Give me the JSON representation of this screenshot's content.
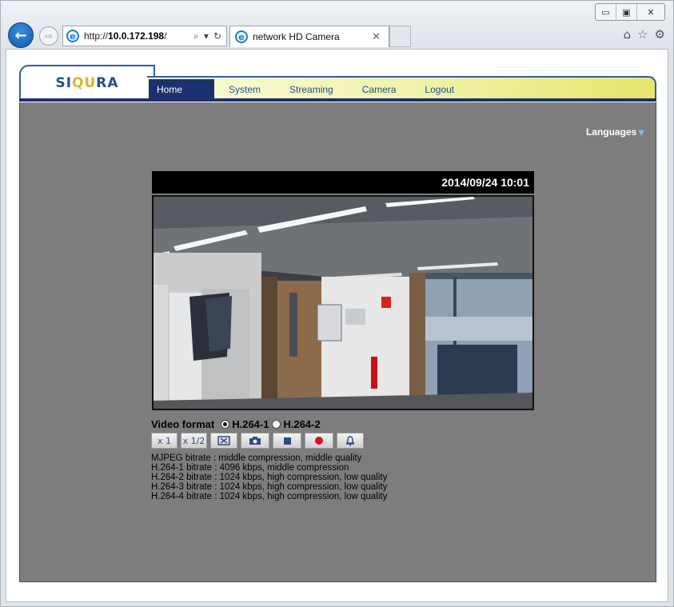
{
  "browser": {
    "url_prefix": "http://",
    "url_host": "10.0.172.198",
    "url_suffix": "/",
    "tab_title": "network HD Camera",
    "window_buttons": [
      "▭",
      "▣",
      "✕"
    ],
    "nav_icons": [
      "home-icon",
      "star-icon",
      "gear-icon"
    ]
  },
  "brand": {
    "logo_main": "SIQURA",
    "logo_accent_color": "#e4b02d",
    "primary_color": "#1f4f93"
  },
  "nav": {
    "items": [
      {
        "label": "Home",
        "active": true
      },
      {
        "label": "System",
        "active": false
      },
      {
        "label": "Streaming",
        "active": false
      },
      {
        "label": "Camera",
        "active": false
      },
      {
        "label": "Logout",
        "active": false
      }
    ]
  },
  "page": {
    "languages_label": "Languages",
    "timestamp": "2014/09/24 10:01",
    "video_format_label": "Video format",
    "video_format_options": [
      {
        "label": "H.264-1",
        "selected": true
      },
      {
        "label": "H.264-2",
        "selected": false
      }
    ],
    "buttons": {
      "zoom_1": "x 1",
      "zoom_half": "x 1/2",
      "fullscreen": "fullscreen-icon",
      "snapshot": "camera-icon",
      "stop": "stop-icon",
      "record": "record-icon",
      "alarm": "bell-icon"
    },
    "bitrate_info": [
      "MJPEG bitrate : middle compression, middle quality",
      "H.264-1 bitrate : 4096 kbps, middle compression",
      "H.264-2 bitrate : 1024 kbps, high compression, low quality",
      "H.264-3 bitrate : 1024 kbps, high compression, low quality",
      "H.264-4 bitrate : 1024 kbps, high compression, low quality"
    ]
  }
}
